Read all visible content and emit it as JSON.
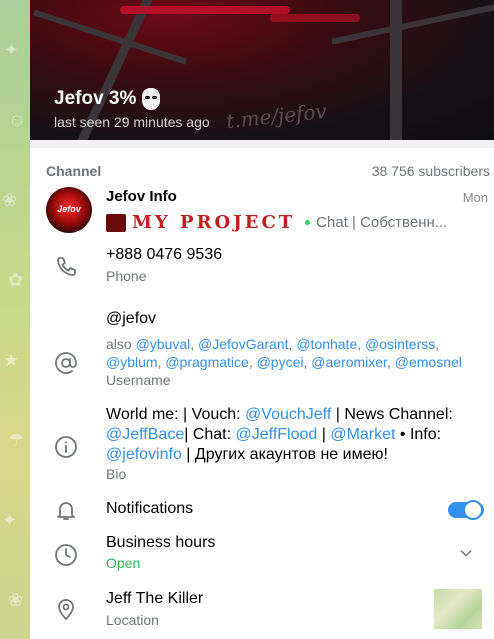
{
  "header": {
    "title": "Jefov 3%",
    "last_seen": "last seen 29 minutes ago",
    "watermark": "t.me/jefov"
  },
  "channel": {
    "section_label": "Channel",
    "subscribers": "38 756 subscribers",
    "name": "Jefov Info",
    "date": "Mon",
    "preview_title": "MY PROJECT",
    "preview_text": "Chat | Собственн...",
    "avatar_text": "Jefov"
  },
  "phone": {
    "value": "+888 0476 9536",
    "label": "Phone"
  },
  "username": {
    "value": "@jefov",
    "also_prefix": "also",
    "also": [
      "@ybuval",
      "@JefovGarant",
      "@tonhate",
      "@osinterss",
      "@yblum",
      "@pragmatice",
      "@pycei",
      "@aeromixer",
      "@emosnel"
    ],
    "label": "Username"
  },
  "bio": {
    "p1": "World me: | Vouch: ",
    "l1": "@VouchJeff",
    "p2": " | News Channel: ",
    "l2": "@JeffBace",
    "p3": "| Chat: ",
    "l3": "@JeffFlood",
    "p4": " | ",
    "l4": "@Market",
    "p5": " • Info: ",
    "l5": "@jefovinfo",
    "p6": " | Других акаунтов не имею!",
    "label": "Bio"
  },
  "notifications": {
    "label": "Notifications",
    "enabled": true
  },
  "business_hours": {
    "label": "Business hours",
    "status": "Open"
  },
  "location": {
    "value": "Jeff The Killer",
    "label": "Location"
  },
  "colors": {
    "accent": "#3390ec",
    "secondary": "#707579",
    "online": "#2fb54f"
  },
  "icons": [
    "phone-icon",
    "at-icon",
    "info-icon",
    "bell-icon",
    "clock-icon",
    "chevron-down-icon",
    "location-pin-icon"
  ]
}
